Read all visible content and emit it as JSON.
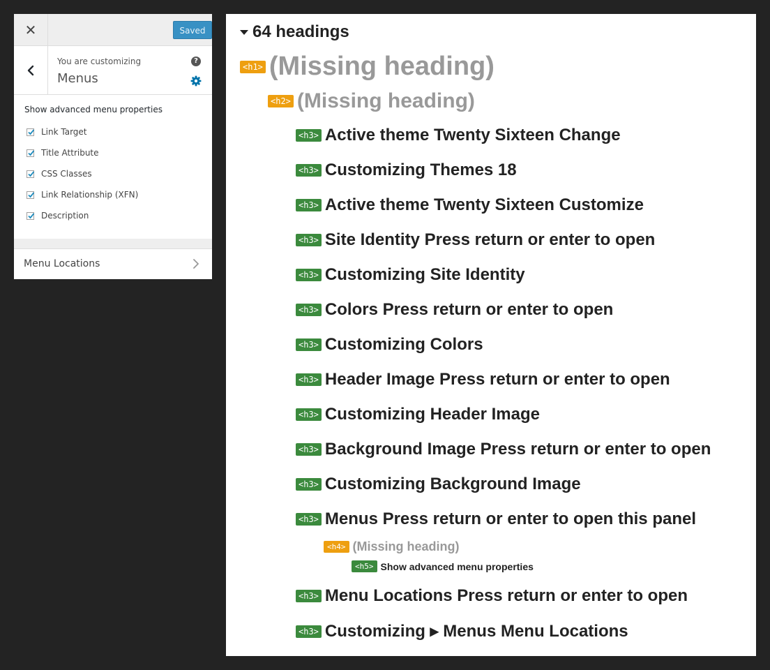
{
  "customizer": {
    "close_symbol": "✕",
    "saved_label": "Saved",
    "customizing_label": "You are customizing",
    "section_title": "Menus",
    "help_symbol": "?",
    "options_title": "Show advanced menu properties",
    "options": [
      {
        "label": "Link Target",
        "checked": true
      },
      {
        "label": "Title Attribute",
        "checked": true
      },
      {
        "label": "CSS Classes",
        "checked": true
      },
      {
        "label": "Link Relationship (XFN)",
        "checked": true
      },
      {
        "label": "Description",
        "checked": true
      }
    ],
    "menu_locations_label": "Menu Locations",
    "icons": [
      "close-icon",
      "back-chevron-icon",
      "help-icon",
      "gear-icon",
      "checkmark-icon",
      "chevron-right-icon"
    ],
    "colors": {
      "button_blue": "#3891c4",
      "gear_blue": "#0073aa",
      "check_green": "#1e8cbe"
    }
  },
  "headings_map": {
    "summary": "64 headings",
    "colors": {
      "missing_tag": "#ee9f10",
      "present_tag": "#3b8a3d",
      "missing_text": "#999999",
      "text": "#222222"
    },
    "headings": [
      {
        "tag": "<h1>",
        "text": "(Missing heading)",
        "missing": true
      },
      {
        "tag": "<h2>",
        "text": "(Missing heading)",
        "missing": true
      },
      {
        "tag": "<h3>",
        "text": "Active theme Twenty Sixteen Change",
        "missing": false
      },
      {
        "tag": "<h3>",
        "text": "Customizing Themes 18",
        "missing": false
      },
      {
        "tag": "<h3>",
        "text": "Active theme Twenty Sixteen Customize",
        "missing": false
      },
      {
        "tag": "<h3>",
        "text": "Site Identity Press return or enter to open",
        "missing": false
      },
      {
        "tag": "<h3>",
        "text": "Customizing Site Identity",
        "missing": false
      },
      {
        "tag": "<h3>",
        "text": "Colors Press return or enter to open",
        "missing": false
      },
      {
        "tag": "<h3>",
        "text": "Customizing Colors",
        "missing": false
      },
      {
        "tag": "<h3>",
        "text": "Header Image Press return or enter to open",
        "missing": false
      },
      {
        "tag": "<h3>",
        "text": "Customizing Header Image",
        "missing": false
      },
      {
        "tag": "<h3>",
        "text": "Background Image Press return or enter to open",
        "missing": false
      },
      {
        "tag": "<h3>",
        "text": "Customizing Background Image",
        "missing": false
      },
      {
        "tag": "<h3>",
        "text": "Menus Press return or enter to open this panel",
        "missing": false
      },
      {
        "tag": "<h4>",
        "text": "(Missing heading)",
        "missing": true
      },
      {
        "tag": "<h5>",
        "text": "Show advanced menu properties",
        "missing": false
      },
      {
        "tag": "<h3>",
        "text": "Menu Locations Press return or enter to open",
        "missing": false
      },
      {
        "tag": "<h3>",
        "text": "Customizing ▸ Menus Menu Locations",
        "missing": false
      }
    ]
  }
}
